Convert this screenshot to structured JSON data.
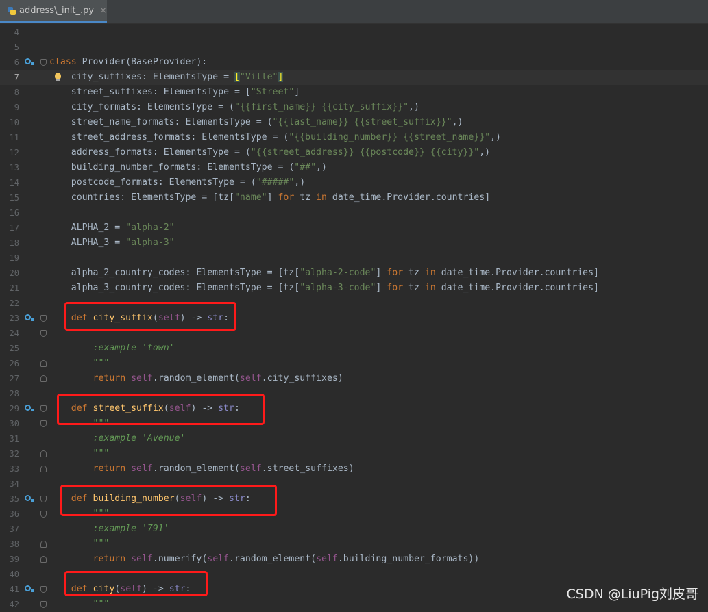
{
  "tab": {
    "filename": "address\\_init_.py",
    "close": "×"
  },
  "lines": [
    {
      "n": "4",
      "t": []
    },
    {
      "n": "5",
      "t": []
    },
    {
      "n": "6",
      "t": [
        [
          "kw",
          "class "
        ],
        [
          "",
          "Provider(BaseProvider):"
        ]
      ]
    },
    {
      "n": "7",
      "t": [
        [
          "",
          "    city_suffixes: ElementsType = "
        ],
        [
          "hl",
          "["
        ],
        [
          "str",
          "\"Ville\""
        ],
        [
          "hl",
          "]"
        ]
      ]
    },
    {
      "n": "8",
      "t": [
        [
          "",
          "    street_suffixes: ElementsType = ["
        ],
        [
          "str",
          "\"Street\""
        ],
        [
          "",
          "]"
        ]
      ]
    },
    {
      "n": "9",
      "t": [
        [
          "",
          "    city_formats: ElementsType = ("
        ],
        [
          "str",
          "\"{{first_name}} {{city_suffix}}\""
        ],
        [
          "",
          ",)"
        ]
      ]
    },
    {
      "n": "10",
      "t": [
        [
          "",
          "    street_name_formats: ElementsType = ("
        ],
        [
          "str",
          "\"{{last_name}} {{street_suffix}}\""
        ],
        [
          "",
          ",)"
        ]
      ]
    },
    {
      "n": "11",
      "t": [
        [
          "",
          "    street_address_formats: ElementsType = ("
        ],
        [
          "str",
          "\"{{building_number}} {{street_name}}\""
        ],
        [
          "",
          ",)"
        ]
      ]
    },
    {
      "n": "12",
      "t": [
        [
          "",
          "    address_formats: ElementsType = ("
        ],
        [
          "str",
          "\"{{street_address}} {{postcode}} {{city}}\""
        ],
        [
          "",
          ",)"
        ]
      ]
    },
    {
      "n": "13",
      "t": [
        [
          "",
          "    building_number_formats: ElementsType = ("
        ],
        [
          "str",
          "\"##\""
        ],
        [
          "",
          ",)"
        ]
      ]
    },
    {
      "n": "14",
      "t": [
        [
          "",
          "    postcode_formats: ElementsType = ("
        ],
        [
          "str",
          "\"#####\""
        ],
        [
          "",
          ",)"
        ]
      ]
    },
    {
      "n": "15",
      "t": [
        [
          "",
          "    countries: ElementsType = [tz["
        ],
        [
          "str",
          "\"name\""
        ],
        [
          "",
          "] "
        ],
        [
          "kw",
          "for"
        ],
        [
          "",
          " tz "
        ],
        [
          "kw",
          "in"
        ],
        [
          "",
          " date_time.Provider.countries]"
        ]
      ]
    },
    {
      "n": "16",
      "t": []
    },
    {
      "n": "17",
      "t": [
        [
          "",
          "    ALPHA_2 = "
        ],
        [
          "str",
          "\"alpha-2\""
        ]
      ]
    },
    {
      "n": "18",
      "t": [
        [
          "",
          "    ALPHA_3 = "
        ],
        [
          "str",
          "\"alpha-3\""
        ]
      ]
    },
    {
      "n": "19",
      "t": []
    },
    {
      "n": "20",
      "t": [
        [
          "",
          "    alpha_2_country_codes: ElementsType = [tz["
        ],
        [
          "str",
          "\"alpha-2-code\""
        ],
        [
          "",
          "] "
        ],
        [
          "kw",
          "for"
        ],
        [
          "",
          " tz "
        ],
        [
          "kw",
          "in"
        ],
        [
          "",
          " date_time.Provider.countries]"
        ]
      ]
    },
    {
      "n": "21",
      "t": [
        [
          "",
          "    alpha_3_country_codes: ElementsType = [tz["
        ],
        [
          "str",
          "\"alpha-3-code\""
        ],
        [
          "",
          "] "
        ],
        [
          "kw",
          "for"
        ],
        [
          "",
          " tz "
        ],
        [
          "kw",
          "in"
        ],
        [
          "",
          " date_time.Provider.countries]"
        ]
      ]
    },
    {
      "n": "22",
      "t": []
    },
    {
      "n": "23",
      "t": [
        [
          "",
          "    "
        ],
        [
          "kw",
          "def "
        ],
        [
          "fn",
          "city_suffix"
        ],
        [
          "",
          "("
        ],
        [
          "self",
          "self"
        ],
        [
          "",
          ") -> "
        ],
        [
          "bi",
          "str"
        ],
        [
          "",
          ":"
        ]
      ]
    },
    {
      "n": "24",
      "t": [
        [
          "doc",
          "        \"\"\""
        ]
      ]
    },
    {
      "n": "25",
      "t": [
        [
          "doc",
          "        :example 'town'"
        ]
      ]
    },
    {
      "n": "26",
      "t": [
        [
          "doc",
          "        \"\"\""
        ]
      ]
    },
    {
      "n": "27",
      "t": [
        [
          "",
          "        "
        ],
        [
          "kw",
          "return "
        ],
        [
          "self",
          "self"
        ],
        [
          "",
          ".random_element("
        ],
        [
          "self",
          "self"
        ],
        [
          "",
          ".city_suffixes)"
        ]
      ]
    },
    {
      "n": "28",
      "t": []
    },
    {
      "n": "29",
      "t": [
        [
          "",
          "    "
        ],
        [
          "kw",
          "def "
        ],
        [
          "fn",
          "street_suffix"
        ],
        [
          "",
          "("
        ],
        [
          "self",
          "self"
        ],
        [
          "",
          ") -> "
        ],
        [
          "bi",
          "str"
        ],
        [
          "",
          ":"
        ]
      ]
    },
    {
      "n": "30",
      "t": [
        [
          "doc",
          "        \"\"\""
        ]
      ]
    },
    {
      "n": "31",
      "t": [
        [
          "doc",
          "        :example 'Avenue'"
        ]
      ]
    },
    {
      "n": "32",
      "t": [
        [
          "doc",
          "        \"\"\""
        ]
      ]
    },
    {
      "n": "33",
      "t": [
        [
          "",
          "        "
        ],
        [
          "kw",
          "return "
        ],
        [
          "self",
          "self"
        ],
        [
          "",
          ".random_element("
        ],
        [
          "self",
          "self"
        ],
        [
          "",
          ".street_suffixes)"
        ]
      ]
    },
    {
      "n": "34",
      "t": []
    },
    {
      "n": "35",
      "t": [
        [
          "",
          "    "
        ],
        [
          "kw",
          "def "
        ],
        [
          "fn",
          "building_number"
        ],
        [
          "",
          "("
        ],
        [
          "self",
          "self"
        ],
        [
          "",
          ") -> "
        ],
        [
          "bi",
          "str"
        ],
        [
          "",
          ":"
        ]
      ]
    },
    {
      "n": "36",
      "t": [
        [
          "doc",
          "        \"\"\""
        ]
      ]
    },
    {
      "n": "37",
      "t": [
        [
          "doc",
          "        :example '791'"
        ]
      ]
    },
    {
      "n": "38",
      "t": [
        [
          "doc",
          "        \"\"\""
        ]
      ]
    },
    {
      "n": "39",
      "t": [
        [
          "",
          "        "
        ],
        [
          "kw",
          "return "
        ],
        [
          "self",
          "self"
        ],
        [
          "",
          ".numerify("
        ],
        [
          "self",
          "self"
        ],
        [
          "",
          ".random_element("
        ],
        [
          "self",
          "self"
        ],
        [
          "",
          ".building_number_formats))"
        ]
      ]
    },
    {
      "n": "40",
      "t": []
    },
    {
      "n": "41",
      "t": [
        [
          "",
          "    "
        ],
        [
          "kw",
          "def "
        ],
        [
          "fn",
          "city"
        ],
        [
          "",
          "("
        ],
        [
          "self",
          "self"
        ],
        [
          "",
          ") -> "
        ],
        [
          "bi",
          "str"
        ],
        [
          "",
          ":"
        ]
      ]
    },
    {
      "n": "42",
      "t": [
        [
          "doc",
          "        \"\"\""
        ]
      ]
    }
  ],
  "watermark": "CSDN @LiuPig刘皮哥"
}
